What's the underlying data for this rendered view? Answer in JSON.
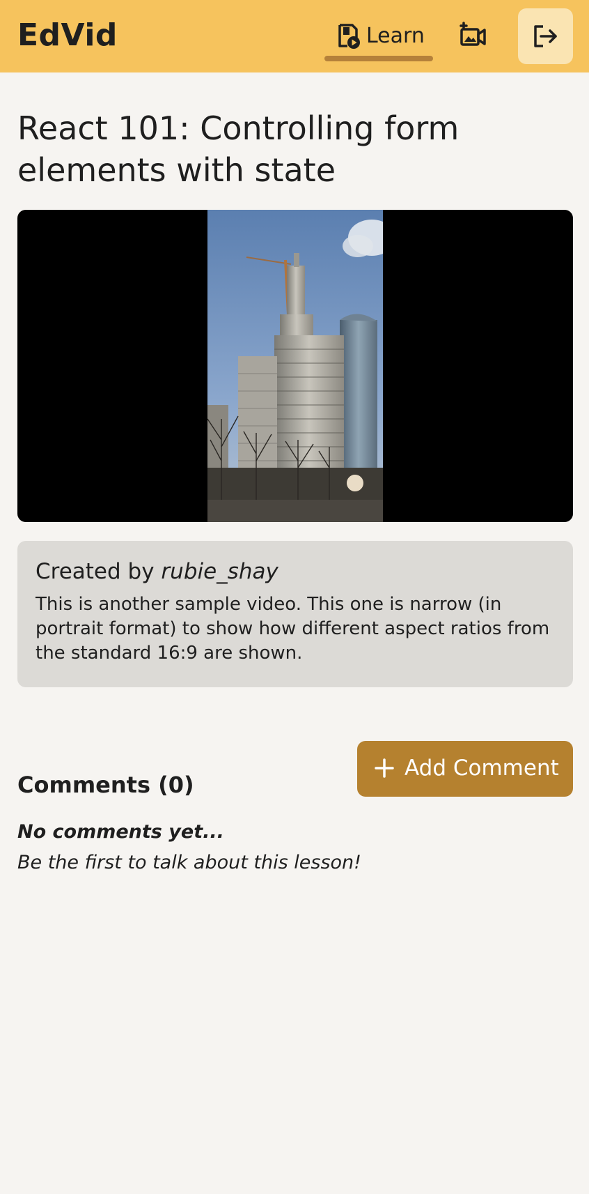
{
  "header": {
    "logo": "EdVid",
    "nav": {
      "learn_label": "Learn",
      "learn_icon": "video-library-icon",
      "upload_icon": "add-video-icon",
      "logout_icon": "logout-icon"
    },
    "colors": {
      "background": "#f6c35d",
      "active_underline": "#b5813a",
      "logout_bg": "#fae4b2"
    }
  },
  "lesson": {
    "title": "React 101: Controlling form elements with state",
    "video": {
      "thumbnail": "city-skyscraper-portrait"
    },
    "created_by_prefix": "Created by",
    "author": "rubie_shay",
    "description": "This is another sample video. This one is narrow (in portrait format) to show how different aspect ratios from the standard 16:9 are shown."
  },
  "comments": {
    "heading": "Comments (0)",
    "add_button_label": "Add Comment",
    "add_button_icon": "plus-icon",
    "empty_title": "No comments yet...",
    "empty_subtitle": "Be the first to talk about this lesson!",
    "colors": {
      "button_bg": "#b5812f"
    }
  }
}
